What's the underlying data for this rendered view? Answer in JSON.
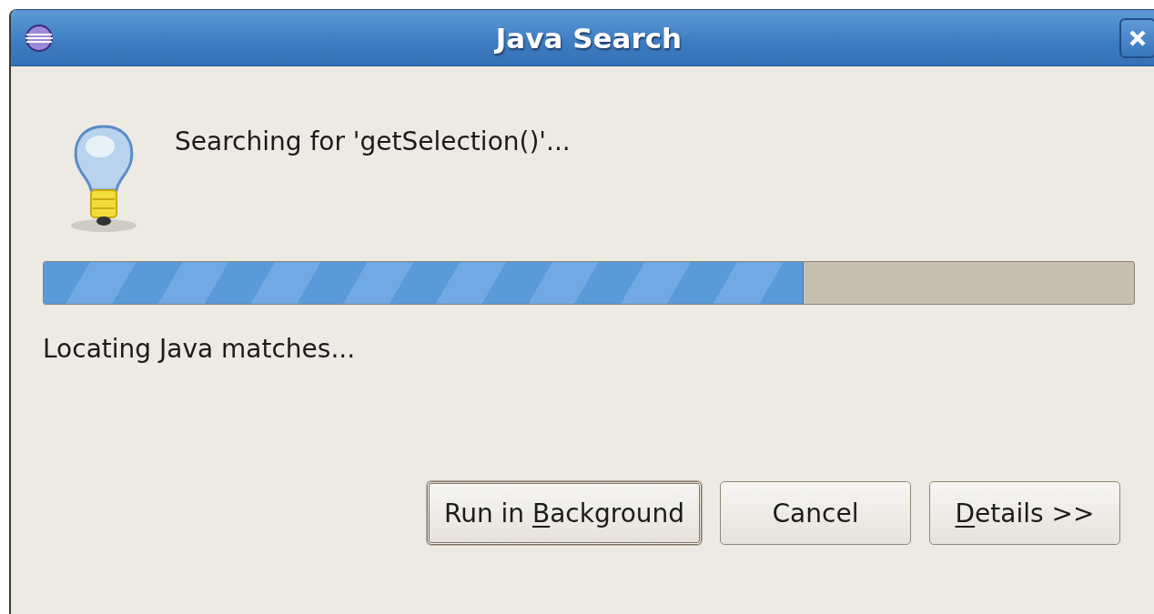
{
  "window": {
    "title": "Java Search"
  },
  "message": "Searching for 'getSelection()'...",
  "progress": {
    "level": 0.697
  },
  "status": "Locating Java matches...",
  "buttons": [
    {
      "before": "Run in ",
      "mnemonic": "B",
      "after": "ackground",
      "default": true
    },
    {
      "before": "Cancel",
      "default": false
    },
    {
      "mnemonic": "D",
      "after": "etails >>",
      "default": false
    }
  ]
}
